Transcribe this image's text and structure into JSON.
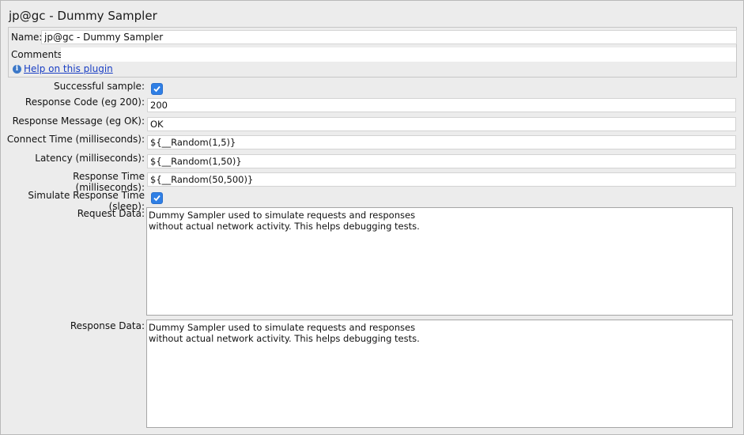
{
  "window_title": "jp@gc - Dummy Sampler",
  "header": {
    "name_label": "Name:",
    "name_value": "jp@gc - Dummy Sampler",
    "comments_label": "Comments:",
    "comments_value": "",
    "help_icon": "info-icon",
    "help_link": "Help on this plugin"
  },
  "form": {
    "successful_sample_label": "Successful sample:",
    "successful_sample_checked": true,
    "response_code_label": "Response Code (eg 200):",
    "response_code_value": "200",
    "response_message_label": "Response Message (eg OK):",
    "response_message_value": "OK",
    "connect_time_label": "Connect Time (milliseconds):",
    "connect_time_value": "${__Random(1,5)}",
    "latency_label": "Latency (milliseconds):",
    "latency_value": "${__Random(1,50)}",
    "response_time_label": "Response Time (milliseconds):",
    "response_time_value": "${__Random(50,500)}",
    "simulate_label": "Simulate Response Time (sleep):",
    "simulate_checked": true,
    "request_data_label": "Request Data:",
    "request_data_value": "Dummy Sampler used to simulate requests and responses\nwithout actual network activity. This helps debugging tests.",
    "response_data_label": "Response Data:",
    "response_data_value": "Dummy Sampler used to simulate requests and responses\nwithout actual network activity. This helps debugging tests."
  },
  "colors": {
    "background": "#ececec",
    "checkbox_accent": "#2f7fe5",
    "link": "#1a3fc4"
  }
}
